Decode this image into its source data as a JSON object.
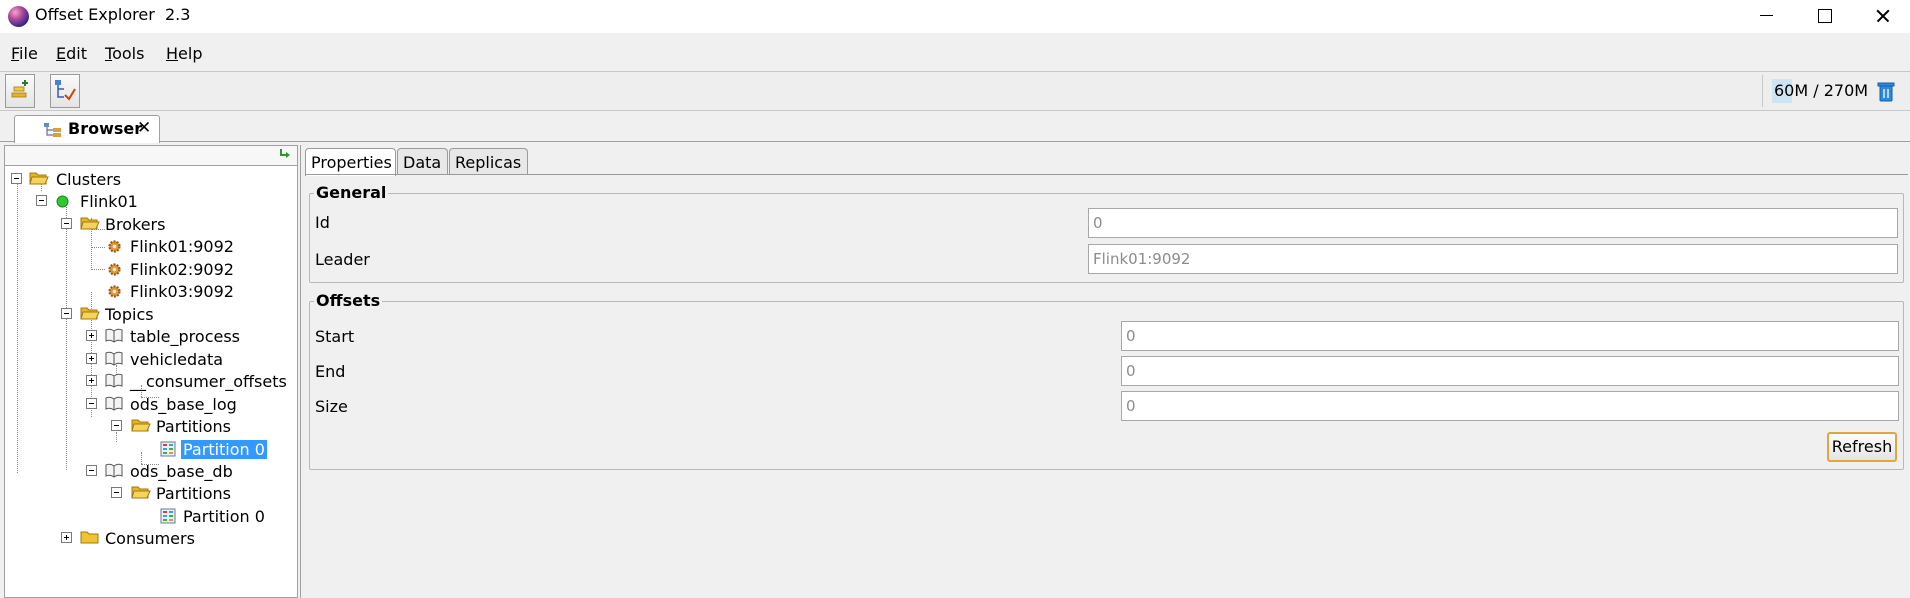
{
  "window": {
    "title": "Offset Explorer  2.3"
  },
  "menu": [
    {
      "label": "File",
      "mnemonic": "F",
      "rest": "ile"
    },
    {
      "label": "Edit",
      "mnemonic": "E",
      "rest": "dit"
    },
    {
      "label": "Tools",
      "mnemonic": "T",
      "rest": "ools"
    },
    {
      "label": "Help",
      "mnemonic": "H",
      "rest": "elp"
    }
  ],
  "toolbar": {
    "buttons": [
      {
        "name": "add-cluster-icon"
      },
      {
        "name": "topic-tree-icon"
      }
    ],
    "memory": "60M / 270M",
    "gc_icon": "trash-icon"
  },
  "tab": {
    "label": "Browser",
    "close": "✕"
  },
  "tree": {
    "refresh_icon": "refresh-arrow-icon",
    "nodes": [
      {
        "label": "Clusters",
        "icon": "folder-open-icon",
        "expander": "minus"
      },
      {
        "label": "Flink01",
        "icon": "status-green-icon",
        "expander": "minus"
      },
      {
        "label": "Brokers",
        "icon": "folder-open-icon",
        "expander": "minus"
      },
      {
        "label": "Flink01:9092",
        "icon": "broker-gear-icon",
        "expander": ""
      },
      {
        "label": "Flink02:9092",
        "icon": "broker-gear-icon",
        "expander": ""
      },
      {
        "label": "Flink03:9092",
        "icon": "broker-gear-icon",
        "expander": ""
      },
      {
        "label": "Topics",
        "icon": "folder-open-icon",
        "expander": "minus"
      },
      {
        "label": "table_process",
        "icon": "topic-book-icon",
        "expander": "plus"
      },
      {
        "label": "vehicledata",
        "icon": "topic-book-icon",
        "expander": "plus"
      },
      {
        "label": "__consumer_offsets",
        "icon": "topic-book-icon",
        "expander": "plus"
      },
      {
        "label": "ods_base_log",
        "icon": "topic-book-icon",
        "expander": "minus"
      },
      {
        "label": "Partitions",
        "icon": "folder-open-icon",
        "expander": "minus"
      },
      {
        "label": "Partition 0",
        "icon": "partition-grid-icon",
        "expander": "",
        "selected": true
      },
      {
        "label": "ods_base_db",
        "icon": "topic-book-icon",
        "expander": "minus"
      },
      {
        "label": "Partitions",
        "icon": "folder-open-icon",
        "expander": "minus"
      },
      {
        "label": "Partition 0",
        "icon": "partition-grid-icon",
        "expander": ""
      },
      {
        "label": "Consumers",
        "icon": "folder-closed-icon",
        "expander": "plus"
      }
    ]
  },
  "detail": {
    "tabs": [
      "Properties",
      "Data",
      "Replicas"
    ],
    "active_tab": "Properties",
    "general": {
      "title": "General",
      "id_label": "Id",
      "id_value": "0",
      "leader_label": "Leader",
      "leader_value": "Flink01:9092"
    },
    "offsets": {
      "title": "Offsets",
      "start_label": "Start",
      "start_value": "0",
      "end_label": "End",
      "end_value": "0",
      "size_label": "Size",
      "size_value": "0",
      "refresh_label": "Refresh"
    }
  },
  "colors": {
    "selection": "#3399ff",
    "status_green": "#22c02a",
    "folder": "#f2c230",
    "refresh_border": "#e0a640"
  }
}
